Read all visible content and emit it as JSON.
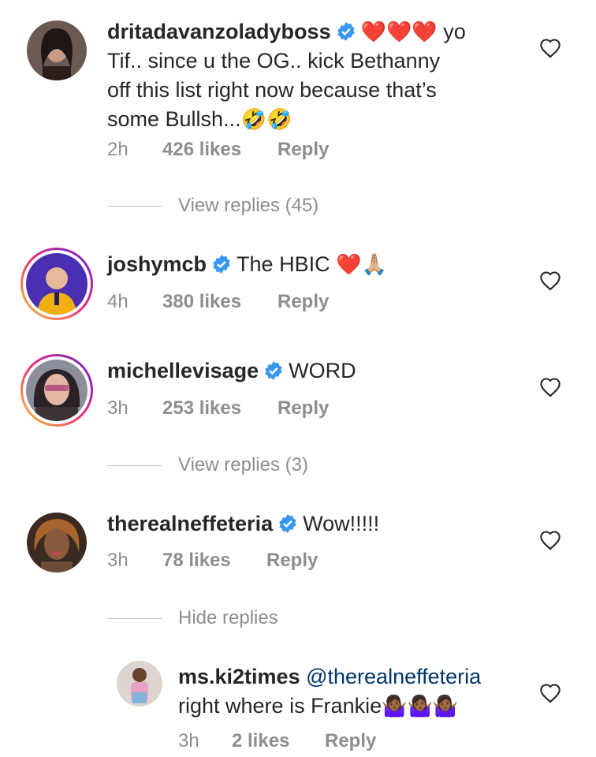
{
  "comments": [
    {
      "username": "dritadavanzoladyboss",
      "text_hearts": "❤️❤️❤️",
      "text_line1": "yo",
      "text_line2": "Tif.. since u the OG.. kick Bethanny",
      "text_line3": "off this list right now because that’s",
      "text_line4": "some Bullsh...",
      "text_emoji": "🤣🤣",
      "time": "2h",
      "likes": "426 likes",
      "reply": "Reply",
      "toggle": "View replies (45)"
    },
    {
      "username": "joshymcb",
      "text": "The HBIC",
      "text_emoji": "❤️🙏🏼",
      "time": "4h",
      "likes": "380 likes",
      "reply": "Reply"
    },
    {
      "username": "michellevisage",
      "text": "WORD",
      "time": "3h",
      "likes": "253 likes",
      "reply": "Reply",
      "toggle": "View replies (3)"
    },
    {
      "username": "therealneffeteria",
      "text": "Wow!!!!!",
      "time": "3h",
      "likes": "78 likes",
      "reply": "Reply",
      "toggle": "Hide replies"
    },
    {
      "username": "ms.ki2times",
      "mention": "@therealneffeteria",
      "text": "right where is Frankie",
      "text_emoji": "🤷🏾‍♀️🤷🏾‍♀️🤷🏾‍♀️",
      "time": "3h",
      "likes": "2 likes",
      "reply": "Reply"
    }
  ],
  "colors": {
    "text": "#262626",
    "meta": "#8e8e8e",
    "verified": "#3897f0",
    "mention": "#003569"
  },
  "icons": [
    "verified-badge-icon",
    "heart-outline-icon"
  ]
}
